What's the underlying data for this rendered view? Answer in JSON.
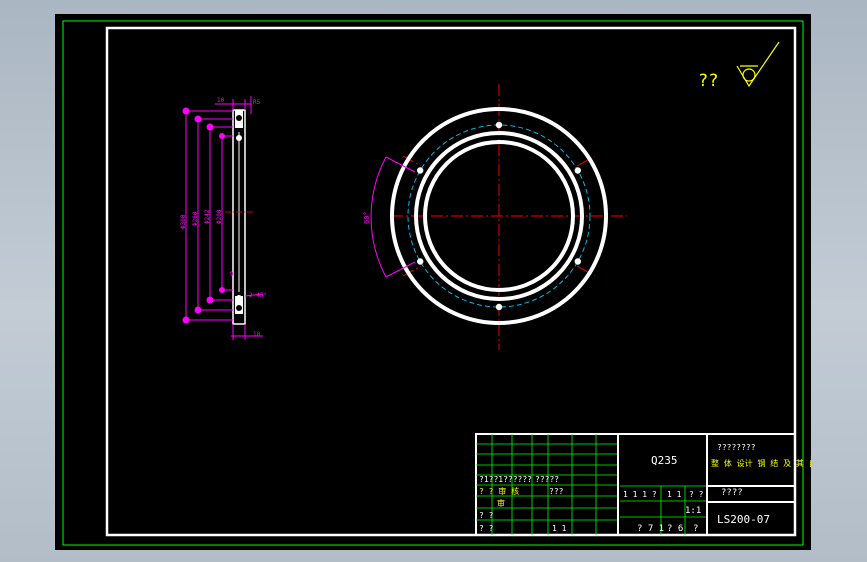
{
  "colors": {
    "background": "#000000",
    "viewport_bg": "#b9c3cd",
    "outer_frame": "#00ff00",
    "inner_frame": "#ffffff",
    "dimension": "#ff00ff",
    "centerline": "#ff0000",
    "bolt_circle": "#00c8ff",
    "annotation": "#ffff00",
    "title_lines": "#00ff00",
    "title_text": "#ffffff"
  },
  "roughness_note": {
    "text": "??",
    "icon": "surface-roughness-check-icon"
  },
  "side_view": {
    "dim_top_a": "10",
    "dim_top_b": "R5",
    "dim_dia_outer": "Φ300",
    "dim_dia_mid": "Φ260",
    "dim_dia_inner": "Φ242",
    "dim_dia_small": "Φ200",
    "dim_label_1": "9",
    "dim_chamfer": "2-45°",
    "dim_bottom": "10"
  },
  "front_view": {
    "angle_label": "60°",
    "hole_count": 6
  },
  "title_block": {
    "material": "Q235",
    "title_top": "????????",
    "title_main": "整 体 设计 钢 结 及 其 自 动 化",
    "title_sub": "????",
    "drawing_no": "LS200-07",
    "scale": "1:1",
    "row1_left": "?1??1??????",
    "row1_b": "?????",
    "row2_mark": "? ? 审 核",
    "row2_b": "???",
    "row3_a": "审",
    "row4_a": "? ?",
    "row5_a": "? ?",
    "row5_b": "1 1",
    "weight_a": "1 1 1 ?",
    "weight_b": "1 1",
    "weight_c": "? ?",
    "sheet_a": "? 7 1",
    "sheet_b": "? 6",
    "sheet_c": "?",
    "code": "?????"
  }
}
